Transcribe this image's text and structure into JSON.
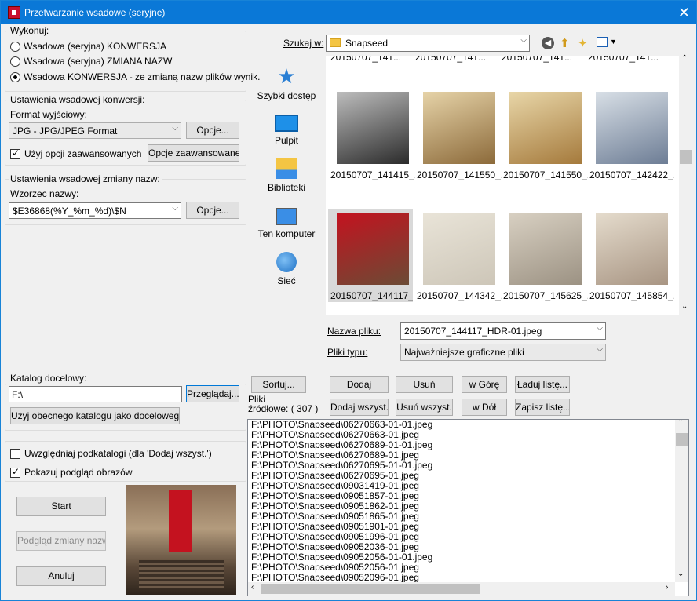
{
  "window": {
    "title": "Przetwarzanie wsadowe (seryjne)"
  },
  "execute": {
    "legend": "Wykonuj:",
    "options": [
      {
        "label": "Wsadowa (seryjna) KONWERSJA",
        "checked": false
      },
      {
        "label": "Wsadowa (seryjna) ZMIANA NAZW",
        "checked": false
      },
      {
        "label": "Wsadowa  KONWERSJA - ze zmianą nazw plików wynik.",
        "checked": true
      }
    ]
  },
  "conversion": {
    "legend": "Ustawienia wsadowej konwersji:",
    "format_label": "Format wyjściowy:",
    "format_value": "JPG - JPG/JPEG Format",
    "options_button": "Opcje...",
    "advanced_checkbox": "Użyj opcji zaawansowanych",
    "advanced_checked": true,
    "advanced_button": "Opcje zaawansowane..."
  },
  "rename": {
    "legend": "Ustawienia wsadowej zmiany nazw:",
    "pattern_label": "Wzorzec nazwy:",
    "pattern_value": "$E36868(%Y_%m_%d)\\$N",
    "options_button": "Opcje..."
  },
  "target": {
    "label": "Katalog docelowy:",
    "value": "F:\\",
    "browse_button": "Przeglądaj...",
    "use_current_button": "Użyj obecnego katalogu jako docelowego"
  },
  "flags": {
    "subfolders_label": "Uwzględniaj podkatalogi  (dla 'Dodaj wszyst.')",
    "subfolders_checked": false,
    "preview_label": "Pokazuj podgląd obrazów",
    "preview_checked": true
  },
  "actions": {
    "start": "Start",
    "preview_rename": "Podgląd zmiany nazw",
    "cancel": "Anuluj"
  },
  "browser": {
    "look_in_label": "Szukaj w:",
    "look_in_value": "Snapseed",
    "places": [
      "Szybki dostęp",
      "Pulpit",
      "Biblioteki",
      "Ten komputer",
      "Sieć"
    ],
    "top_partial": [
      "20150707_141...",
      "20150707_141...",
      "20150707_141...",
      "20150707_141..."
    ],
    "thumbs": [
      {
        "name": "20150707_141415_...",
        "colors": [
          "#2b2b2b",
          "#bdbdbd"
        ]
      },
      {
        "name": "20150707_141550_...",
        "colors": [
          "#8c6a3a",
          "#e6d3a8"
        ]
      },
      {
        "name": "20150707_141550_...",
        "colors": [
          "#a57a3c",
          "#e8d6a8"
        ]
      },
      {
        "name": "20150707_142422_...",
        "colors": [
          "#6d7d95",
          "#d8dfe6"
        ]
      },
      {
        "name": "20150707_144117_...",
        "colors": [
          "#6b4b35",
          "#c4121f"
        ]
      },
      {
        "name": "20150707_144342_...",
        "colors": [
          "#cdc6b8",
          "#e9e4d8"
        ]
      },
      {
        "name": "20150707_145625_...",
        "colors": [
          "#9c9283",
          "#d8d0c2"
        ]
      },
      {
        "name": "20150707_145854_...",
        "colors": [
          "#a89583",
          "#e5dccd"
        ]
      }
    ],
    "filename_label": "Nazwa pliku:",
    "filename_value": "20150707_144117_HDR-01.jpeg",
    "filetype_label": "Pliki typu:",
    "filetype_value": "Najważniejsze graficzne pliki"
  },
  "source": {
    "sort_button": "Sortuj...",
    "label": "Pliki\nźródłowe: ( 307 )",
    "add": "Dodaj",
    "remove": "Usuń",
    "up": "w Górę",
    "load_list": "Ładuj listę...",
    "add_all": "Dodaj wszyst.",
    "remove_all": "Usuń wszyst.",
    "down": "w Dół",
    "save_list": "Zapisz listę...",
    "files": [
      "F:\\PHOTO\\Snapseed\\06270663-01-01.jpeg",
      "F:\\PHOTO\\Snapseed\\06270663-01.jpeg",
      "F:\\PHOTO\\Snapseed\\06270689-01-01.jpeg",
      "F:\\PHOTO\\Snapseed\\06270689-01.jpeg",
      "F:\\PHOTO\\Snapseed\\06270695-01-01.jpeg",
      "F:\\PHOTO\\Snapseed\\06270695-01.jpeg",
      "F:\\PHOTO\\Snapseed\\09031419-01.jpeg",
      "F:\\PHOTO\\Snapseed\\09051857-01.jpeg",
      "F:\\PHOTO\\Snapseed\\09051862-01.jpeg",
      "F:\\PHOTO\\Snapseed\\09051865-01.jpeg",
      "F:\\PHOTO\\Snapseed\\09051901-01.jpeg",
      "F:\\PHOTO\\Snapseed\\09051996-01.jpeg",
      "F:\\PHOTO\\Snapseed\\09052036-01.jpeg",
      "F:\\PHOTO\\Snapseed\\09052056-01-01.jpeg",
      "F:\\PHOTO\\Snapseed\\09052056-01.jpeg",
      "F:\\PHOTO\\Snapseed\\09052096-01.jpeg"
    ]
  }
}
